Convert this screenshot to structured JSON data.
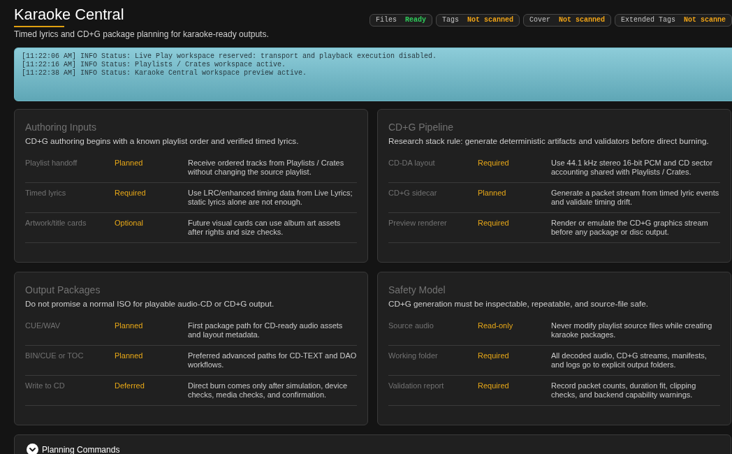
{
  "header": {
    "title": "Karaoke Central",
    "subtitle": "Timed lyrics and CD+G package planning for karaoke-ready outputs."
  },
  "status_pills": [
    {
      "label": "Files",
      "value": "Ready",
      "kind": "ready"
    },
    {
      "label": "Tags",
      "value": "Not scanned",
      "kind": "pending"
    },
    {
      "label": "Cover",
      "value": "Not scanned",
      "kind": "pending"
    },
    {
      "label": "Extended Tags",
      "value": "Not scanne",
      "kind": "pending"
    }
  ],
  "log": {
    "lines": [
      "[11:22:06 AM] INFO Status: Live Play workspace reserved: transport and playback execution disabled.",
      "[11:22:16 AM] INFO Status: Playlists / Crates workspace active.",
      "[11:22:38 AM] INFO Status: Karaoke Central workspace preview active."
    ]
  },
  "cards": [
    {
      "title": "Authoring Inputs",
      "description": "CD+G authoring begins with a known playlist order and verified timed lyrics.",
      "rows": [
        {
          "item": "Playlist handoff",
          "status": "Planned",
          "note": "Receive ordered tracks from Playlists / Crates without changing the source playlist."
        },
        {
          "item": "Timed lyrics",
          "status": "Required",
          "note": "Use LRC/enhanced timing data from Live Lyrics; static lyrics alone are not enough."
        },
        {
          "item": "Artwork/title cards",
          "status": "Optional",
          "note": "Future visual cards can use album art assets after rights and size checks."
        }
      ]
    },
    {
      "title": "CD+G Pipeline",
      "description": "Research stack rule: generate deterministic artifacts and validators before direct burning.",
      "rows": [
        {
          "item": "CD-DA layout",
          "status": "Required",
          "note": "Use 44.1 kHz stereo 16-bit PCM and CD sector accounting shared with Playlists / Crates."
        },
        {
          "item": "CD+G sidecar",
          "status": "Planned",
          "note": "Generate a packet stream from timed lyric events and validate timing drift."
        },
        {
          "item": "Preview renderer",
          "status": "Required",
          "note": "Render or emulate the CD+G graphics stream before any package or disc output."
        }
      ]
    },
    {
      "title": "Output Packages",
      "description": "Do not promise a normal ISO for playable audio-CD or CD+G output.",
      "rows": [
        {
          "item": "CUE/WAV",
          "status": "Planned",
          "note": "First package path for CD-ready audio assets and layout metadata."
        },
        {
          "item": "BIN/CUE or TOC",
          "status": "Planned",
          "note": "Preferred advanced paths for CD-TEXT and DAO workflows."
        },
        {
          "item": "Write to CD",
          "status": "Deferred",
          "note": "Direct burn comes only after simulation, device checks, media checks, and confirmation."
        }
      ]
    },
    {
      "title": "Safety Model",
      "description": "CD+G generation must be inspectable, repeatable, and source-file safe.",
      "rows": [
        {
          "item": "Source audio",
          "status": "Read-only",
          "note": "Never modify playlist source files while creating karaoke packages."
        },
        {
          "item": "Working folder",
          "status": "Required",
          "note": "All decoded audio, CD+G streams, manifests, and logs go to explicit output folders."
        },
        {
          "item": "Validation report",
          "status": "Required",
          "note": "Record packet counts, duration fit, clipping checks, and backend capability warnings."
        }
      ]
    }
  ],
  "collapsible": {
    "title": "Planning Commands"
  }
}
